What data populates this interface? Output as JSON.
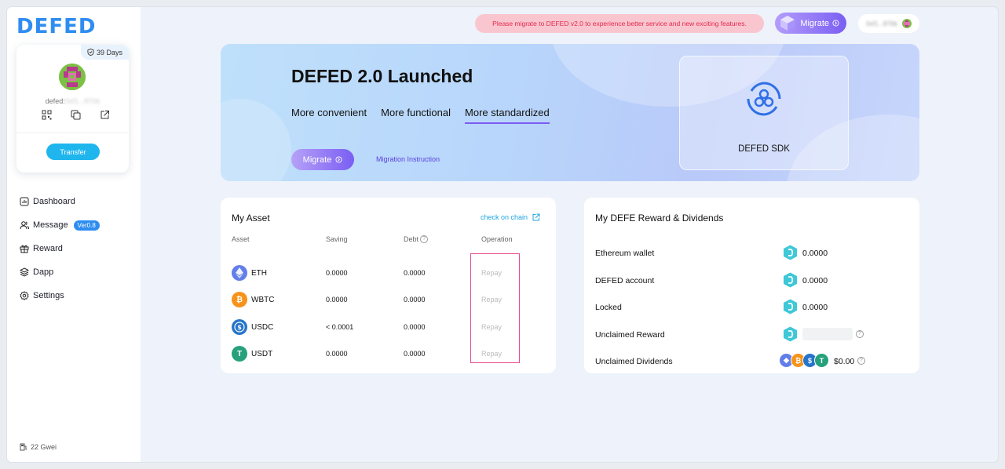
{
  "brand": {
    "logo_text": "DEFED",
    "accent": "#2f8df0"
  },
  "profile": {
    "days_badge": "39 Days",
    "address_prefix": "defed:",
    "address_masked": "0xf1...870b",
    "transfer_label": "Transfer"
  },
  "sidebar": {
    "items": [
      {
        "label": "Dashboard",
        "icon": "dashboard-icon"
      },
      {
        "label": "Message",
        "icon": "users-icon",
        "badge": "Ver0.8"
      },
      {
        "label": "Reward",
        "icon": "gift-icon"
      },
      {
        "label": "Dapp",
        "icon": "layers-icon"
      },
      {
        "label": "Settings",
        "icon": "gear-icon"
      }
    ],
    "gas": "22 Gwei"
  },
  "topbar": {
    "notice": "Please migrate to DEFED v2.0 to experience better service and new exciting features.",
    "migrate_label": "Migrate",
    "wallet_masked": "0xf1...870b"
  },
  "banner": {
    "title": "DEFED 2.0 Launched",
    "tabs": [
      "More convenient",
      "More functional",
      "More standardized"
    ],
    "active_tab": "More standardized",
    "migrate_label": "Migrate",
    "instruction_link": "Migration Instruction",
    "sdk_label": "DEFED SDK"
  },
  "assets": {
    "title": "My Asset",
    "chain_link": "check on chain",
    "columns": [
      "Asset",
      "Saving",
      "Debt",
      "Operation"
    ],
    "rows": [
      {
        "symbol": "ETH",
        "saving": "0.0000",
        "debt": "0.0000",
        "op": "Repay",
        "color": "#627eea"
      },
      {
        "symbol": "WBTC",
        "saving": "0.0000",
        "debt": "0.0000",
        "op": "Repay",
        "color": "#f7931a"
      },
      {
        "symbol": "USDC",
        "saving": "< 0.0001",
        "debt": "0.0000",
        "op": "Repay",
        "color": "#2775ca"
      },
      {
        "symbol": "USDT",
        "saving": "0.0000",
        "debt": "0.0000",
        "op": "Repay",
        "color": "#26a17b"
      }
    ]
  },
  "rewards": {
    "title": "My DEFE Reward & Dividends",
    "rows": [
      {
        "label": "Ethereum wallet",
        "value": "0.0000"
      },
      {
        "label": "DEFED account",
        "value": "0.0000"
      },
      {
        "label": "Locked",
        "value": "0.0000"
      },
      {
        "label": "Unclaimed Reward",
        "value": ""
      },
      {
        "label": "Unclaimed Dividends",
        "value": "$0.00"
      }
    ]
  }
}
